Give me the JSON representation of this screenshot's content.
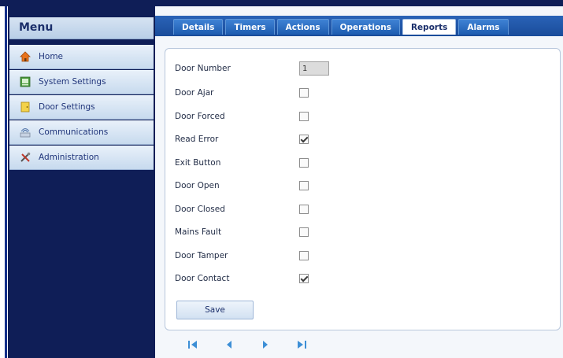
{
  "sidebar": {
    "menu_title": "Menu",
    "items": [
      {
        "label": "Home",
        "icon": "home-icon"
      },
      {
        "label": "System Settings",
        "icon": "system-settings-icon"
      },
      {
        "label": "Door Settings",
        "icon": "door-icon"
      },
      {
        "label": "Communications",
        "icon": "communications-icon"
      },
      {
        "label": "Administration",
        "icon": "tools-icon"
      }
    ]
  },
  "tabs": [
    {
      "label": "Details",
      "active": false
    },
    {
      "label": "Timers",
      "active": false
    },
    {
      "label": "Actions",
      "active": false
    },
    {
      "label": "Operations",
      "active": false
    },
    {
      "label": "Reports",
      "active": true
    },
    {
      "label": "Alarms",
      "active": false
    }
  ],
  "form": {
    "door_number_label": "Door Number",
    "door_number_value": "1",
    "checkboxes": [
      {
        "label": "Door Ajar",
        "checked": false
      },
      {
        "label": "Door Forced",
        "checked": false
      },
      {
        "label": "Read Error",
        "checked": true
      },
      {
        "label": "Exit Button",
        "checked": false
      },
      {
        "label": "Door Open",
        "checked": false
      },
      {
        "label": "Door Closed",
        "checked": false
      },
      {
        "label": "Mains Fault",
        "checked": false
      },
      {
        "label": "Door Tamper",
        "checked": false
      },
      {
        "label": "Door Contact",
        "checked": true
      }
    ],
    "save_label": "Save"
  },
  "pager": [
    "first-page-icon",
    "previous-page-icon",
    "next-page-icon",
    "last-page-icon"
  ],
  "colors": {
    "sidebar_bg": "#0f1e57",
    "tab_strip": "#1a4c9a",
    "active_tab_text": "#1b2f6b"
  }
}
